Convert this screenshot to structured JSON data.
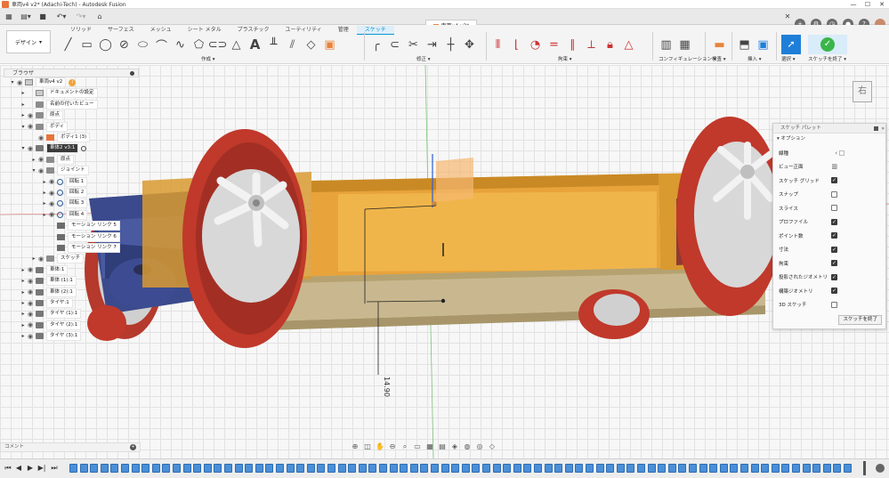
{
  "window": {
    "title": "車両v4 v2* (Adachi-Tech) - Autodesk Fusion",
    "controls": [
      "—",
      "☐",
      "✕"
    ]
  },
  "qat": {
    "doc_tab": "車両v4 v2*"
  },
  "ribbon": {
    "design_label": "デザイン",
    "tabs": [
      "ソリッド",
      "サーフェス",
      "メッシュ",
      "シート メタル",
      "プラスチック",
      "ユーティリティ",
      "管理",
      "スケッチ"
    ],
    "active_tab": "スケッチ",
    "groups": [
      "作成 ▾",
      "修正 ▾",
      "拘束 ▾",
      "コンフィギュレーション ▾",
      "検査 ▾",
      "挿入 ▾",
      "選択 ▾",
      "スケッチを終了 ▾"
    ]
  },
  "browser": {
    "header": "ブラウザ",
    "nodes": [
      {
        "label": "車両v4 v2",
        "icon": "document",
        "expand": "▾",
        "eye": true,
        "badge": true,
        "level": 0
      },
      {
        "label": "ドキュメントの設定",
        "icon": "gear",
        "expand": "▸",
        "eye": false,
        "level": 1
      },
      {
        "label": "名前の付いたビュー",
        "icon": "folder",
        "expand": "▸",
        "eye": false,
        "level": 1
      },
      {
        "label": "原点",
        "icon": "folder",
        "expand": "▸",
        "eye": true,
        "level": 1
      },
      {
        "label": "ボディ",
        "icon": "folder",
        "expand": "▾",
        "eye": true,
        "level": 1
      },
      {
        "label": "ボディ1 (3)",
        "icon": "body",
        "expand": "",
        "eye": true,
        "level": 2
      },
      {
        "label": "車体2 v3:1",
        "icon": "component",
        "expand": "▾",
        "eye": true,
        "selected": true,
        "target": true,
        "level": 1
      },
      {
        "label": "原点",
        "icon": "folder",
        "expand": "▸",
        "eye": true,
        "level": 2
      },
      {
        "label": "ジョイント",
        "icon": "folder",
        "expand": "▾",
        "eye": true,
        "level": 2
      },
      {
        "label": "回転 1",
        "icon": "joint",
        "expand": "▸",
        "eye": true,
        "level": 3
      },
      {
        "label": "回転 2",
        "icon": "joint",
        "expand": "▸",
        "eye": true,
        "level": 3
      },
      {
        "label": "回転 3",
        "icon": "joint",
        "expand": "▸",
        "eye": true,
        "level": 3
      },
      {
        "label": "回転 4",
        "icon": "joint",
        "expand": "▸",
        "eye": true,
        "level": 3
      },
      {
        "label": "モーション リンク 5",
        "icon": "link",
        "expand": "",
        "eye": false,
        "level": 3
      },
      {
        "label": "モーション リンク 6",
        "icon": "link",
        "expand": "",
        "eye": false,
        "level": 3
      },
      {
        "label": "モーション リンク 7",
        "icon": "link",
        "expand": "",
        "eye": false,
        "level": 3
      },
      {
        "label": "スケッチ",
        "icon": "folder",
        "expand": "▸",
        "eye": true,
        "level": 2
      },
      {
        "label": "車体:1",
        "icon": "component",
        "expand": "▸",
        "eye": true,
        "level": 1
      },
      {
        "label": "車体 (1):1",
        "icon": "component",
        "expand": "▸",
        "eye": true,
        "level": 1
      },
      {
        "label": "車体 (2):1",
        "icon": "component",
        "expand": "▸",
        "eye": true,
        "level": 1
      },
      {
        "label": "タイヤ:1",
        "icon": "component",
        "expand": "▸",
        "eye": true,
        "level": 1
      },
      {
        "label": "タイヤ (1):1",
        "icon": "component",
        "expand": "▸",
        "eye": true,
        "level": 1
      },
      {
        "label": "タイヤ (2):1",
        "icon": "component",
        "expand": "▸",
        "eye": true,
        "level": 1
      },
      {
        "label": "タイヤ (3):1",
        "icon": "component",
        "expand": "▸",
        "eye": true,
        "level": 1
      }
    ]
  },
  "palette": {
    "header": "スケッチ パレット",
    "section": "オプション",
    "rows": [
      {
        "label": "線種",
        "type": "icons",
        "checked": false
      },
      {
        "label": "ビュー正面",
        "type": "icon",
        "checked": false
      },
      {
        "label": "スケッチ グリッド",
        "type": "check",
        "checked": true
      },
      {
        "label": "スナップ",
        "type": "check",
        "checked": false
      },
      {
        "label": "スライス",
        "type": "check",
        "checked": false
      },
      {
        "label": "プロファイル",
        "type": "check",
        "checked": true
      },
      {
        "label": "ポイント数",
        "type": "check",
        "checked": true
      },
      {
        "label": "寸法",
        "type": "check",
        "checked": true
      },
      {
        "label": "拘束",
        "type": "check",
        "checked": true
      },
      {
        "label": "投影されたジオメトリ",
        "type": "check",
        "checked": true
      },
      {
        "label": "構築ジオメトリ",
        "type": "check",
        "checked": true
      },
      {
        "label": "3D スケッチ",
        "type": "check",
        "checked": false
      }
    ],
    "finish_label": "スケッチを終了"
  },
  "viewcube": {
    "face_label": "右"
  },
  "dimension": {
    "value": "14.90"
  },
  "comments": {
    "label": "コメント"
  },
  "colors": {
    "accent": "#0696d7",
    "body_orange": "#e8a33a",
    "tire_red": "#c0392b",
    "frame_navy": "#3b4a8c"
  }
}
